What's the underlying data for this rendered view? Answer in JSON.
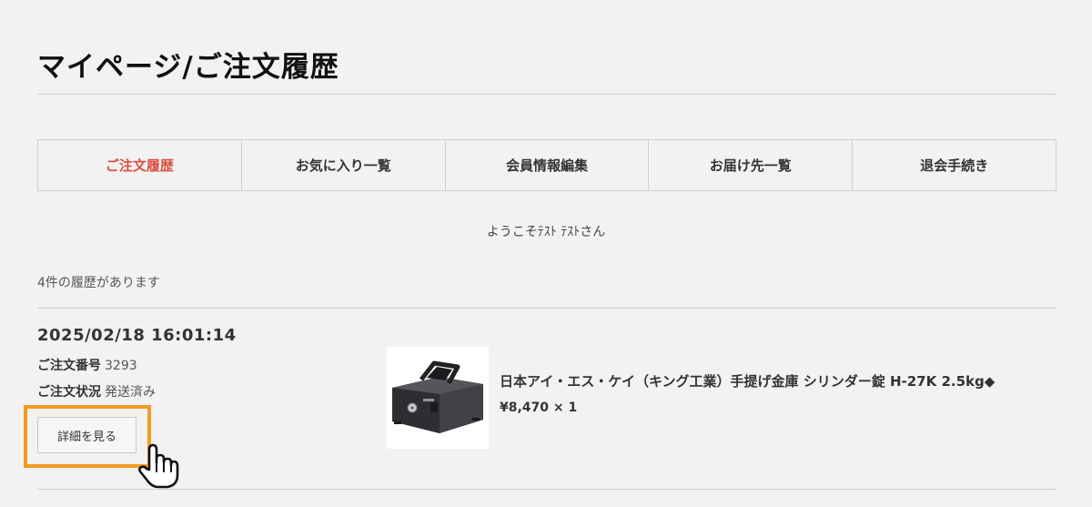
{
  "page": {
    "title": "マイページ/ご注文履歴"
  },
  "tabs": [
    {
      "label": "ご注文履歴",
      "active": true
    },
    {
      "label": "お気に入り一覧",
      "active": false
    },
    {
      "label": "会員情報編集",
      "active": false
    },
    {
      "label": "お届け先一覧",
      "active": false
    },
    {
      "label": "退会手続き",
      "active": false
    }
  ],
  "welcome": "ようこそﾃｽﾄ ﾃｽﾄさん",
  "history_count": "4件の履歴があります",
  "orders": [
    {
      "datetime": "2025/02/18 16:01:14",
      "order_no_label": "ご注文番号",
      "order_no": "3293",
      "status_label": "ご注文状況",
      "status": "発送済み",
      "detail_button": "詳細を見る",
      "items": [
        {
          "name": "日本アイ・エス・ケイ（キング工業）手提げ金庫 シリンダー錠 H-27K 2.5kg◆",
          "price": "¥8,470 × 1",
          "image": "cash-box-image"
        }
      ]
    }
  ],
  "colors": {
    "active_tab": "#d9503f",
    "highlight": "#f39a21",
    "background": "#f2f2f2"
  }
}
